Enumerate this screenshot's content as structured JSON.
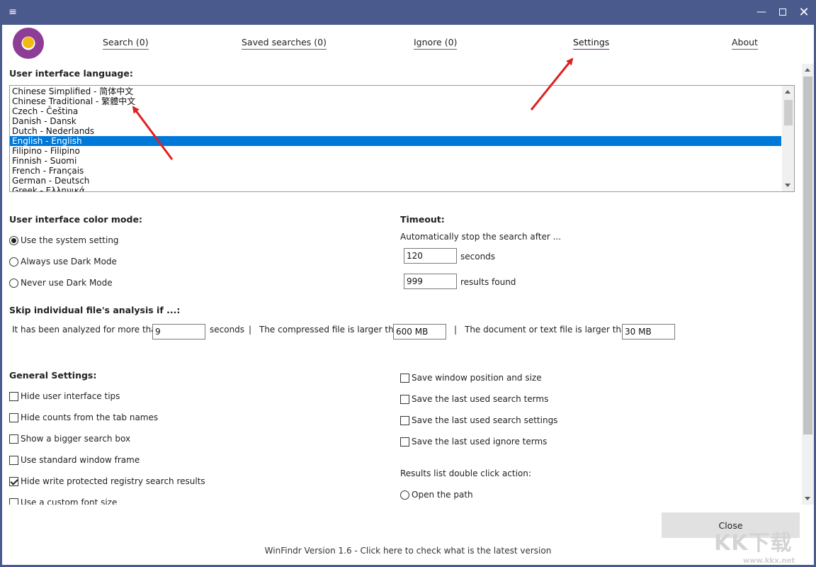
{
  "tabs": [
    {
      "label": "Search (0)"
    },
    {
      "label": "Saved searches (0)"
    },
    {
      "label": "Ignore (0)"
    },
    {
      "label": "Settings"
    },
    {
      "label": "About"
    }
  ],
  "language": {
    "heading": "User interface language:",
    "items": [
      "Chinese Simplified - 简体中文",
      "Chinese Traditional - 繁體中文",
      "Czech - Čeština",
      "Danish - Dansk",
      "Dutch - Nederlands",
      "English - English",
      "Filipino - Filipino",
      "Finnish - Suomi",
      "French - Français",
      "German - Deutsch",
      "Greek - Ελληνικά"
    ],
    "selected": "English - English"
  },
  "color_mode": {
    "heading": "User interface color mode:",
    "options": [
      "Use the system setting",
      "Always use Dark Mode",
      "Never use Dark Mode"
    ],
    "selected": "Use the system setting"
  },
  "timeout": {
    "heading": "Timeout:",
    "description": "Automatically stop the search after ...",
    "seconds_value": "120",
    "seconds_label": "seconds",
    "results_value": "999",
    "results_label": "results found"
  },
  "skip": {
    "heading": "Skip individual file's analysis if ...:",
    "analyzed_label": "It has been analyzed for more than",
    "analyzed_value": "9",
    "analyzed_unit": "seconds",
    "sep": "|",
    "compressed_label": "The compressed file is larger than",
    "compressed_value": "600 MB",
    "document_label": "The document or text file is larger than",
    "document_value": "30 MB"
  },
  "general": {
    "heading": "General Settings:",
    "left": [
      {
        "label": "Hide user interface tips",
        "checked": false
      },
      {
        "label": "Hide counts from the tab names",
        "checked": false
      },
      {
        "label": "Show a bigger search box",
        "checked": false
      },
      {
        "label": "Use standard window frame",
        "checked": false
      },
      {
        "label": "Hide write protected registry search results",
        "checked": true
      },
      {
        "label": "Use a custom font size",
        "checked": false
      }
    ],
    "right": [
      {
        "label": "Save window position and size",
        "checked": false
      },
      {
        "label": "Save the last used search terms",
        "checked": false
      },
      {
        "label": "Save the last used search settings",
        "checked": false
      },
      {
        "label": "Save the last used ignore terms",
        "checked": false
      }
    ],
    "double_click_label": "Results list double click action:",
    "double_click_option": "Open the path"
  },
  "close_label": "Close",
  "footer": "WinFindr Version 1.6 - Click here to check what is the latest version",
  "watermark": {
    "main": "KK下载",
    "sub": "www.kkx.net"
  },
  "colors": {
    "titlebar": "#4a5a8c",
    "selection": "#0078d7",
    "arrow": "#e02020",
    "logo": "#8e3d97"
  }
}
